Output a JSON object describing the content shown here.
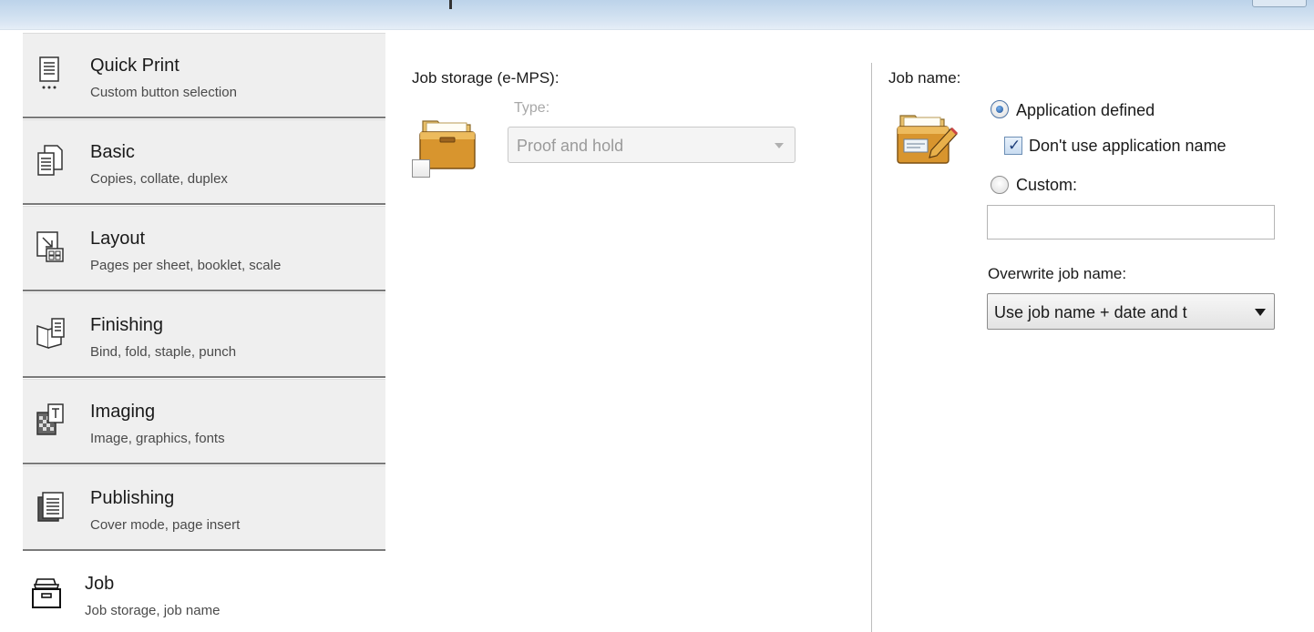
{
  "nav": {
    "items": [
      {
        "title": "Quick Print",
        "subtitle": "Custom button selection",
        "icon": "quick-print-icon"
      },
      {
        "title": "Basic",
        "subtitle": "Copies, collate, duplex",
        "icon": "basic-document-icon"
      },
      {
        "title": "Layout",
        "subtitle": "Pages per sheet, booklet, scale",
        "icon": "layout-icon"
      },
      {
        "title": "Finishing",
        "subtitle": "Bind, fold, staple, punch",
        "icon": "finishing-icon"
      },
      {
        "title": "Imaging",
        "subtitle": "Image, graphics, fonts",
        "icon": "imaging-icon"
      },
      {
        "title": "Publishing",
        "subtitle": "Cover mode, page insert",
        "icon": "publishing-icon"
      },
      {
        "title": "Job",
        "subtitle": "Job storage, job name",
        "icon": "job-tray-icon",
        "active": true
      }
    ]
  },
  "job_storage": {
    "heading": "Job storage (e-MPS):",
    "enabled": false,
    "type_label": "Type:",
    "type_value": "Proof and hold",
    "icon": "file-box-icon"
  },
  "job_name": {
    "heading": "Job name:",
    "icon": "file-box-edit-icon",
    "application_defined_label": "Application defined",
    "application_defined_selected": true,
    "dont_use_app_name_label": "Don't use application name",
    "dont_use_app_name_checked": true,
    "custom_label": "Custom:",
    "custom_selected": false,
    "custom_value": "",
    "overwrite_label": "Overwrite job name:",
    "overwrite_value": "Use job name + date and t"
  }
}
